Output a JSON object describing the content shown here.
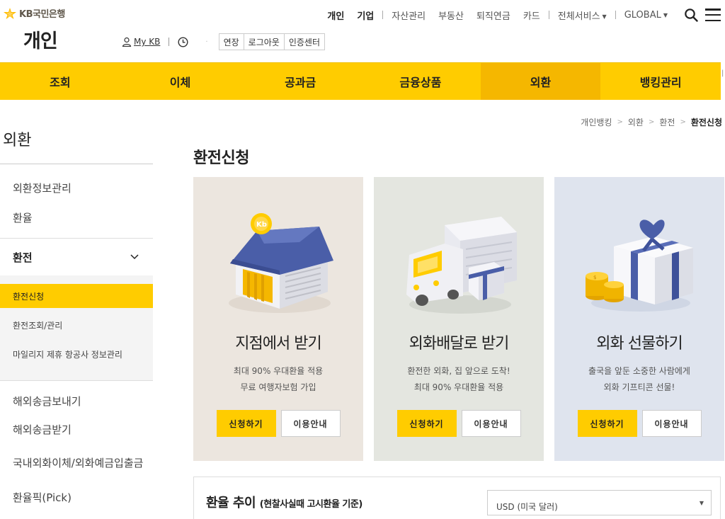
{
  "brand": {
    "logo_text": "KB국민은행",
    "section": "개인"
  },
  "util": {
    "mykb_label": "My KB",
    "buttons": [
      "연장",
      "로그아웃",
      "인증센터"
    ]
  },
  "gnb": {
    "items": [
      "개인",
      "기업",
      "자산관리",
      "부동산",
      "퇴직연금",
      "카드",
      "전체서비스",
      "GLOBAL"
    ]
  },
  "mainnav": {
    "items": [
      "조회",
      "이체",
      "공과금",
      "금융상품",
      "외환",
      "뱅킹관리"
    ],
    "active_index": 4
  },
  "breadcrumb": [
    "개인뱅킹",
    "외환",
    "환전",
    "환전신청"
  ],
  "lnb": {
    "title": "외환",
    "top_items": [
      "외환정보관리",
      "환율"
    ],
    "group_title": "환전",
    "sub_items": [
      "환전신청",
      "환전조회/관리",
      "마일리지 제휴 항공사 정보관리"
    ],
    "bottom_items": [
      "해외송금보내기",
      "해외송금받기",
      "국내외화이체/외화예금입출금",
      "환율픽(Pick)"
    ]
  },
  "page_title": "환전신청",
  "cards": [
    {
      "title": "지점에서 받기",
      "desc1": "최대 90% 우대환율 적용",
      "desc2": "무료 여행자보험 가입",
      "apply": "신청하기",
      "guide": "이용안내",
      "bg": "#ece6df"
    },
    {
      "title": "외화배달로 받기",
      "desc1": "환전한 외화, 집 앞으로 도착!",
      "desc2": "최대 90% 우대환율 적용",
      "apply": "신청하기",
      "guide": "이용안내",
      "bg": "#e4e6e0"
    },
    {
      "title": "외화 선물하기",
      "desc1": "출국을 앞둔 소중한 사람에게",
      "desc2": "외화 기프티콘 선물!",
      "apply": "신청하기",
      "guide": "이용안내",
      "bg": "#dfe4ee"
    }
  ],
  "rate": {
    "title": "환율 추이",
    "subtitle": "(현찰사실때 고시환율 기준)",
    "select_value": "USD (미국 달러)"
  },
  "colors": {
    "brand_yellow": "#ffcc00",
    "active_yellow": "#f5b700"
  }
}
